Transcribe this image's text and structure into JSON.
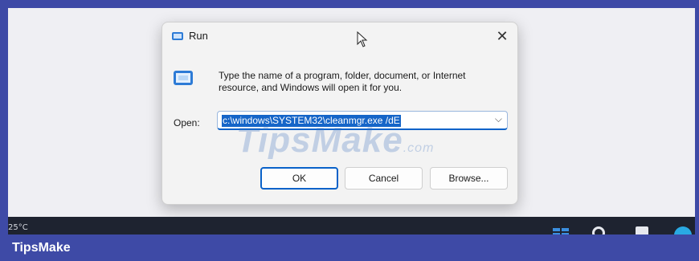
{
  "dialog": {
    "title": "Run",
    "close_glyph": "✕",
    "description": "Type the name of a program, folder, document, or Internet resource, and Windows will open it for you.",
    "open_label": "Open:",
    "open_value": "c:\\windows\\SYSTEM32\\cleanmgr.exe /dE",
    "dropdown_glyph": "⌵",
    "buttons": {
      "ok": "OK",
      "cancel": "Cancel",
      "browse": "Browse..."
    }
  },
  "watermark": {
    "main": "TipsMake",
    "suffix": ".com"
  },
  "taskbar": {
    "weather": "25°C"
  },
  "footer": {
    "brand": "TipsMake"
  },
  "colors": {
    "frame": "#3e4aa6",
    "accent": "#0a62c9",
    "taskbar": "#1e2330"
  },
  "icons": [
    "run-app-icon",
    "close-icon",
    "mouse-pointer-icon",
    "chevron-down-icon",
    "windows-start-icon",
    "search-icon",
    "task-view-icon",
    "edge-icon"
  ]
}
